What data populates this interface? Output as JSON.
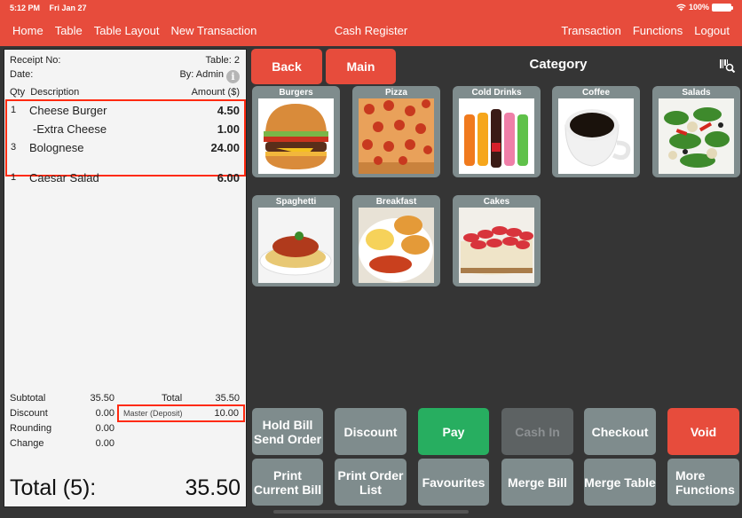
{
  "status_bar": {
    "time": "5:12 PM",
    "date": "Fri Jan 27",
    "battery": "100%"
  },
  "nav": {
    "left": [
      "Home",
      "Table",
      "Table Layout",
      "New Transaction"
    ],
    "title": "Cash Register",
    "right": [
      "Transaction",
      "Functions",
      "Logout"
    ]
  },
  "receipt": {
    "receipt_no_label": "Receipt No:",
    "table_label": "Table: 2",
    "date_label": "Date:",
    "by_label": "By: Admin",
    "info_icon": "i",
    "headers": {
      "qty_desc": "Qty  Description",
      "amount": "Amount ($)"
    },
    "items": [
      {
        "qty": "1",
        "description": "Cheese Burger",
        "amount": "4.50"
      },
      {
        "qty": "",
        "description": "-Extra Cheese",
        "amount": "1.00"
      },
      {
        "qty": "3",
        "description": "Bolognese",
        "amount": "24.00"
      },
      {
        "qty": "1",
        "description": "Caesar Salad",
        "amount": "6.00"
      }
    ],
    "totals": {
      "subtotal_label": "Subtotal",
      "subtotal": "35.50",
      "discount_label": "Discount",
      "discount": "0.00",
      "rounding_label": "Rounding",
      "rounding": "0.00",
      "change_label": "Change",
      "change": "0.00",
      "total_label": "Total",
      "total": "35.50",
      "deposit_label": "Master (Deposit)",
      "deposit": "10.00"
    },
    "grand_total_label": "Total (5):",
    "grand_total": "35.50"
  },
  "category_panel": {
    "back": "Back",
    "main": "Main",
    "title": "Category",
    "barcode_icon": "barcode-search-icon",
    "tiles": [
      "Burgers",
      "Pizza",
      "Cold Drinks",
      "Coffee",
      "Salads",
      "Spaghetti",
      "Breakfast",
      "Cakes"
    ]
  },
  "actions": {
    "hold_bill": "Hold Bill Send Order",
    "discount": "Discount",
    "pay": "Pay",
    "cash_in": "Cash In",
    "checkout": "Checkout",
    "void": "Void",
    "print_current_bill": "Print Current Bill",
    "print_order_list": "Print Order List",
    "favourites": "Favourites",
    "merge_bill": "Merge Bill",
    "merge_table": "Merge Table",
    "more_functions": "More Functions"
  },
  "colors": {
    "brand": "#e74c3c",
    "pay": "#27ae60",
    "button": "#7f8c8d",
    "background": "#353535"
  }
}
